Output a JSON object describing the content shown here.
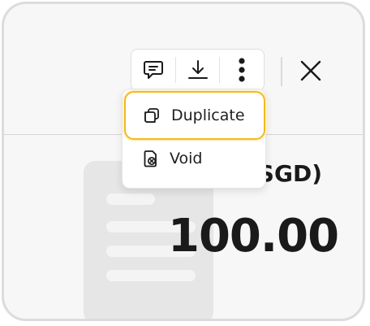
{
  "toolbar": {
    "comment_icon": "chat-bubble-icon",
    "download_icon": "download-icon",
    "more_icon": "more-vertical-icon",
    "close_icon": "close-icon"
  },
  "menu": {
    "items": [
      {
        "label": "Duplicate",
        "icon": "duplicate-icon",
        "highlighted": true
      },
      {
        "label": "Void",
        "icon": "void-icon",
        "highlighted": false
      }
    ]
  },
  "summary": {
    "currency_label": "(SGD)",
    "amount": "100.00"
  },
  "colors": {
    "highlight_border": "#f3b91d",
    "text": "#1a1a1a",
    "illustration": "#e4e4e4"
  }
}
